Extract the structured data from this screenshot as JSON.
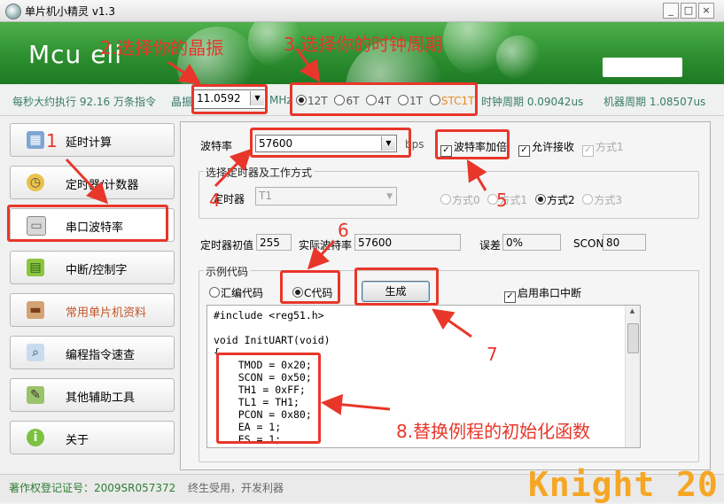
{
  "window": {
    "title": "单片机小精灵  v1.3",
    "buttons": [
      "_",
      "□",
      "×"
    ]
  },
  "banner": {
    "logo": "Mcu eli"
  },
  "info": {
    "exec_speed": "每秒大约执行 92.16 万条指令",
    "crystal_label": "晶振",
    "crystal_value": "11.0592",
    "unit": "MHz",
    "cycle_options": [
      "12T",
      "6T",
      "4T",
      "1T",
      "STC1T"
    ],
    "cycle_selected": "12T",
    "clock_period": "时钟周期 0.09042us",
    "machine_period": "机器周期 1.08507us"
  },
  "sidebar": {
    "items": [
      {
        "label": "延时计算",
        "icon": "calculator-icon"
      },
      {
        "label": "定时器/计数器",
        "icon": "alarm-clock-icon"
      },
      {
        "label": "串口波特率",
        "icon": "monitor-icon"
      },
      {
        "label": "中断/控制字",
        "icon": "chip-icon"
      },
      {
        "label": "常用单片机资料",
        "icon": "book-icon"
      },
      {
        "label": "编程指令速查",
        "icon": "magnifier-icon"
      },
      {
        "label": "其他辅助工具",
        "icon": "tools-icon"
      },
      {
        "label": "关于",
        "icon": "info-icon"
      }
    ]
  },
  "baud": {
    "label": "波特率",
    "value": "57600",
    "unit": "bps",
    "double_label": "波特率加倍",
    "allow_recv_label": "允许接收",
    "mode1_top_label": "方式1"
  },
  "timer_group": {
    "title": "选择定时器及工作方式",
    "timer_label": "定时器",
    "timer_value": "T1",
    "modes": [
      "方式0",
      "方式1",
      "方式2",
      "方式3"
    ],
    "mode_selected": "方式2"
  },
  "results": {
    "init_label": "定时器初值",
    "init_value": "255",
    "actual_label": "实际波特率",
    "actual_value": "57600",
    "error_label": "误差",
    "error_value": "0%",
    "scon_label": "SCON",
    "scon_value": "80"
  },
  "code_group": {
    "title": "示例代码",
    "asm_label": "汇编代码",
    "c_label": "C代码",
    "generate_label": "生成",
    "enable_int_label": "启用串口中断",
    "lines": [
      "#include <reg51.h>",
      "",
      "void InitUART(void)",
      "{",
      "    TMOD = 0x20;",
      "    SCON = 0x50;",
      "    TH1 = 0xFF;",
      "    TL1 = TH1;",
      "    PCON = 0x80;",
      "    EA = 1;",
      "    ES = 1;"
    ]
  },
  "status": {
    "copyright": "著作权登记证号：2009SR057372",
    "slogan": "终生受用，开发利器"
  },
  "annotations": {
    "a1": "1",
    "a2": "2.选择你的晶振",
    "a3": "3.选择你的时钟周期",
    "a4": "4",
    "a5": "5",
    "a6": "6",
    "a7": "7",
    "a8": "8.替换例程的初始化函数",
    "watermark": "Knight 20"
  },
  "colors": {
    "annotation": "#e8362a",
    "banner": "#2d8f30",
    "watermark": "#f5a623"
  }
}
